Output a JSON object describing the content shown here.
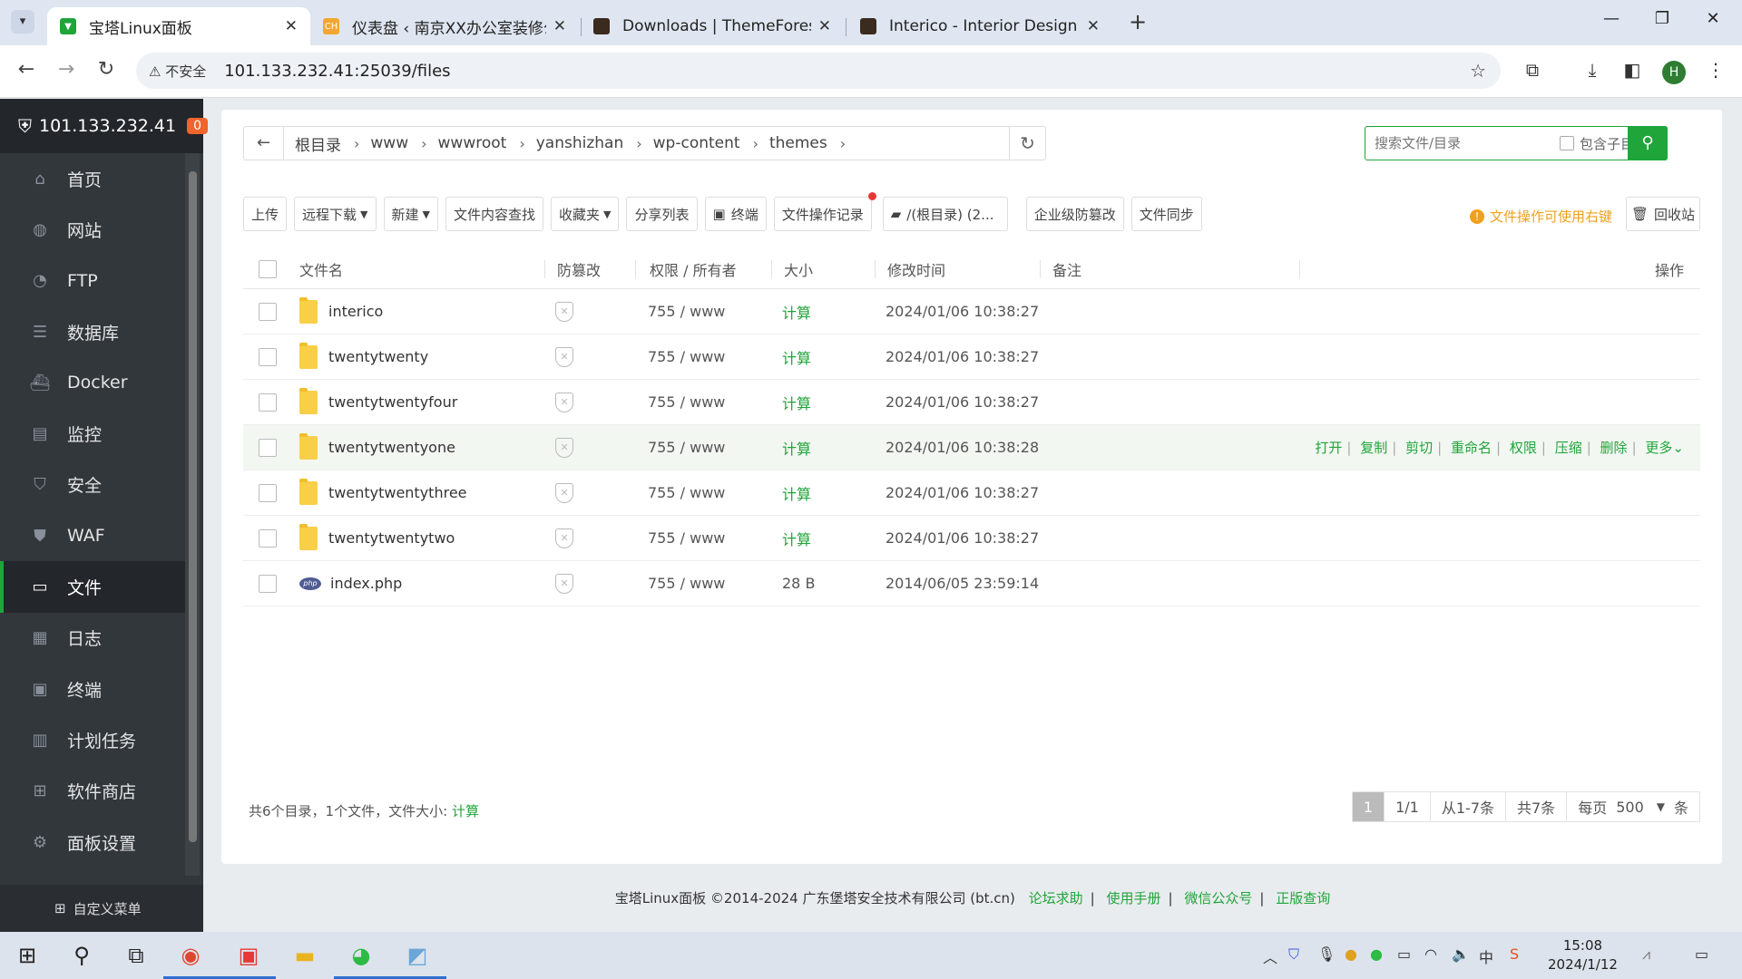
{
  "browser": {
    "tabs": [
      {
        "title": "宝塔Linux面板",
        "active": true
      },
      {
        "title": "仪表盘 ‹ 南京XX办公室装修公司",
        "active": false
      },
      {
        "title": "Downloads | ThemeForest",
        "active": false
      },
      {
        "title": "Interico - Interior Design & Ar",
        "active": false
      }
    ],
    "security_label": "不安全",
    "url": "101.133.232.41:25039/files",
    "profile_initial": "H"
  },
  "sidebar": {
    "server_ip": "101.133.232.41",
    "alert_count": "0",
    "items": [
      {
        "label": "首页",
        "icon": "home-icon"
      },
      {
        "label": "网站",
        "icon": "globe-icon"
      },
      {
        "label": "FTP",
        "icon": "ftp-icon"
      },
      {
        "label": "数据库",
        "icon": "database-icon"
      },
      {
        "label": "Docker",
        "icon": "docker-icon"
      },
      {
        "label": "监控",
        "icon": "monitor-icon"
      },
      {
        "label": "安全",
        "icon": "shield-icon"
      },
      {
        "label": "WAF",
        "icon": "waf-icon"
      },
      {
        "label": "文件",
        "icon": "folder-icon",
        "active": true
      },
      {
        "label": "日志",
        "icon": "log-icon"
      },
      {
        "label": "终端",
        "icon": "terminal-icon"
      },
      {
        "label": "计划任务",
        "icon": "calendar-icon"
      },
      {
        "label": "软件商店",
        "icon": "grid-icon"
      },
      {
        "label": "面板设置",
        "icon": "gear-icon"
      }
    ],
    "custom_menu": "自定义菜单"
  },
  "breadcrumb": [
    "根目录",
    "www",
    "wwwroot",
    "yanshizhan",
    "wp-content",
    "themes"
  ],
  "search": {
    "placeholder": "搜索文件/目录",
    "include_subdir": "包含子目录"
  },
  "toolbar": {
    "upload": "上传",
    "remote_download": "远程下载",
    "new": "新建",
    "content_search": "文件内容查找",
    "favorites": "收藏夹",
    "share_list": "分享列表",
    "terminal": "终端",
    "file_log": "文件操作记录",
    "disk": "/(根目录) (2...",
    "tamper_proof": "企业级防篡改",
    "file_sync": "文件同步",
    "tip": "文件操作可使用右键",
    "recycle": "回收站"
  },
  "table": {
    "headers": {
      "name": "文件名",
      "guard": "防篡改",
      "perm": "权限 / 所有者",
      "size": "大小",
      "mtime": "修改时间",
      "note": "备注",
      "ops": "操作"
    },
    "rows": [
      {
        "name": "interico",
        "type": "folder",
        "perm": "755 / www",
        "size": "计算",
        "mtime": "2024/01/06 10:38:27"
      },
      {
        "name": "twentytwenty",
        "type": "folder",
        "perm": "755 / www",
        "size": "计算",
        "mtime": "2024/01/06 10:38:27"
      },
      {
        "name": "twentytwentyfour",
        "type": "folder",
        "perm": "755 / www",
        "size": "计算",
        "mtime": "2024/01/06 10:38:27"
      },
      {
        "name": "twentytwentyone",
        "type": "folder",
        "perm": "755 / www",
        "size": "计算",
        "mtime": "2024/01/06 10:38:28",
        "hover": true
      },
      {
        "name": "twentytwentythree",
        "type": "folder",
        "perm": "755 / www",
        "size": "计算",
        "mtime": "2024/01/06 10:38:27"
      },
      {
        "name": "twentytwentytwo",
        "type": "folder",
        "perm": "755 / www",
        "size": "计算",
        "mtime": "2024/01/06 10:38:27"
      },
      {
        "name": "index.php",
        "type": "php",
        "perm": "755 / www",
        "size": "28 B",
        "mtime": "2014/06/05 23:59:14"
      }
    ],
    "row_actions": [
      "打开",
      "复制",
      "剪切",
      "重命名",
      "权限",
      "压缩",
      "删除",
      "更多"
    ]
  },
  "summary": {
    "text": "共6个目录，1个文件，文件大小:",
    "calc": "计算"
  },
  "pager": {
    "current": "1",
    "pages": "1/1",
    "range": "从1-7条",
    "total": "共7条",
    "per_page_label": "每页",
    "per_page": "500",
    "unit": "条"
  },
  "footer": {
    "copyright": "宝塔Linux面板 ©2014-2024 广东堡塔安全技术有限公司 (bt.cn)",
    "links": [
      "论坛求助",
      "使用手册",
      "微信公众号",
      "正版查询"
    ]
  },
  "taskbar": {
    "time": "15:08",
    "date": "2024/1/12"
  },
  "colors": {
    "accent": "#20a53a",
    "sidebar": "#32373c",
    "warning": "#f0a020"
  }
}
